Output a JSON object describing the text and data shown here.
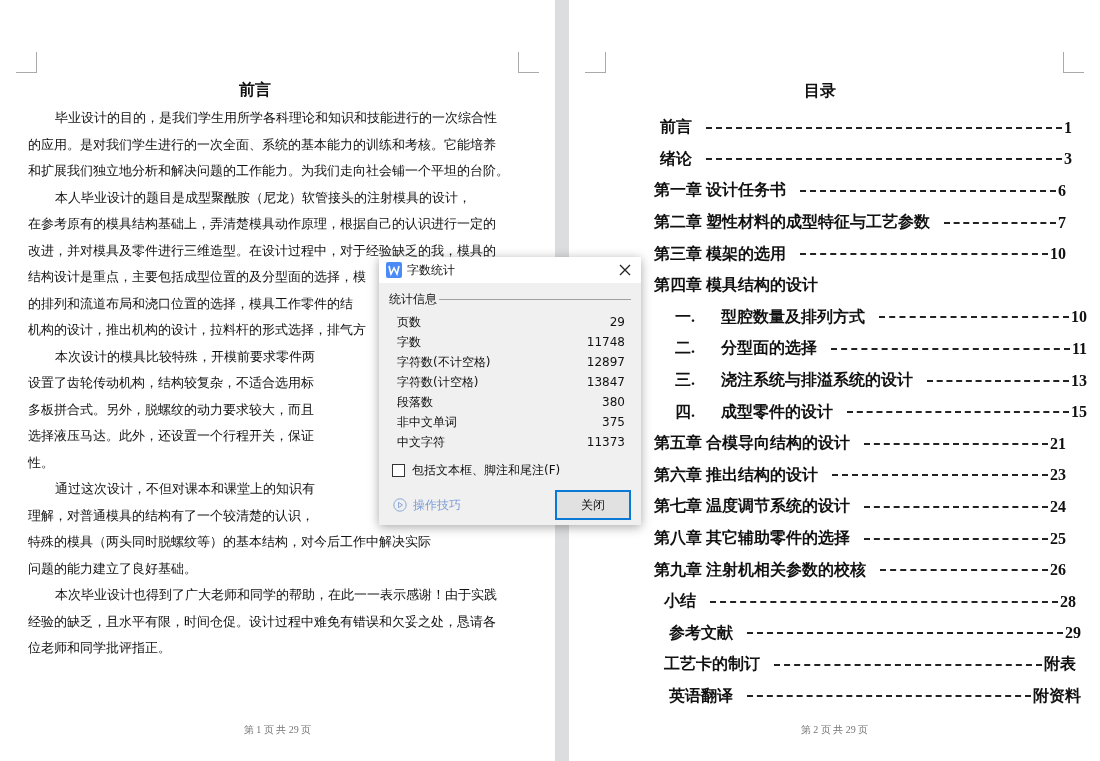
{
  "left_page": {
    "heading": "前言",
    "lines": [
      {
        "text": "毕业设计的目的，是我们学生用所学各科理论和知识和技能进行的一次综合性",
        "indent": true
      },
      {
        "text": "的应用。是对我们学生进行的一次全面、系统的基本能力的训练和考核。它能培养",
        "indent": false
      },
      {
        "text": "和扩展我们独立地分析和解决问题的工作能力。为我们走向社会铺一个平坦的台阶。",
        "indent": false
      },
      {
        "text": "本人毕业设计的题目是成型聚酰胺（尼龙）软管接头的注射模具的设计，",
        "indent": true
      },
      {
        "text": "在参考原有的模具结构基础上，弄清楚模具动作原理，根据自己的认识进行一定的",
        "indent": false
      },
      {
        "text": "改进，并对模具及零件进行三维造型。在设计过程中，对于经验缺乏的我，模具的",
        "indent": false
      },
      {
        "text": "结构设计是重点，主要包括成型位置的及分型面的选择，模",
        "indent": false
      },
      {
        "text": "的排列和流道布局和浇口位置的选择，模具工作零件的结",
        "indent": false
      },
      {
        "text": "机构的设计，推出机构的设计，拉料杆的形式选择，排气方",
        "indent": false
      },
      {
        "text": "本次设计的模具比较特殊，开模前要求零件两",
        "indent": true
      },
      {
        "text": "设置了齿轮传动机构，结构较复杂，不适合选用标",
        "indent": false
      },
      {
        "text": "多板拼合式。另外，脱螺纹的动力要求较大，而且",
        "indent": false
      },
      {
        "text": "选择液压马达。此外，还设置一个行程开关，保证",
        "indent": false
      },
      {
        "text": "性。",
        "indent": false
      },
      {
        "text": "通过这次设计，不但对课本和课堂上的知识有",
        "indent": true
      },
      {
        "text": "理解，对普通模具的结构有了一个较清楚的认识，",
        "indent": false
      },
      {
        "text": "特殊的模具（两头同时脱螺纹等）的基本结构，对今后工作中解决实际",
        "indent": false
      },
      {
        "text": "问题的能力建立了良好基础。",
        "indent": false
      },
      {
        "text": "本次毕业设计也得到了广大老师和同学的帮助，在此一一表示感谢！由于实践",
        "indent": true
      },
      {
        "text": "经验的缺乏，且水平有限，时间仓促。设计过程中难免有错误和欠妥之处，恳请各",
        "indent": false
      },
      {
        "text": "位老师和同学批评指正。",
        "indent": false
      }
    ],
    "footer": "第 1 页 共 29 页"
  },
  "right_page": {
    "heading": "目录",
    "toc": [
      {
        "kind": "front",
        "title": "前言",
        "page": "1"
      },
      {
        "kind": "front",
        "title": "绪论",
        "page": "3"
      },
      {
        "kind": "chapter",
        "title": "第一章  设计任务书",
        "page": "6"
      },
      {
        "kind": "chapter",
        "title": "第二章  塑性材料的成型特征与工艺参数",
        "page": "7"
      },
      {
        "kind": "chapter",
        "title": "第三章  模架的选用",
        "page": "10"
      },
      {
        "kind": "chapter",
        "title": "第四章  模具结构的设计"
      },
      {
        "kind": "section",
        "number": "一.",
        "title": "型腔数量及排列方式",
        "page": "10"
      },
      {
        "kind": "section",
        "number": "二.",
        "title": "分型面的选择",
        "page": "11"
      },
      {
        "kind": "section",
        "number": "三.",
        "title": "浇注系统与排溢系统的设计",
        "page": "13"
      },
      {
        "kind": "section",
        "number": "四.",
        "title": "成型零件的设计",
        "page": "15"
      },
      {
        "kind": "chapter",
        "title": "第五章  合模导向结构的设计",
        "page": "21"
      },
      {
        "kind": "chapter",
        "title": "第六章  推出结构的设计",
        "page": "23"
      },
      {
        "kind": "chapter",
        "title": "第七章  温度调节系统的设计",
        "page": "24"
      },
      {
        "kind": "chapter",
        "title": "第八章  其它辅助零件的选择",
        "page": "25"
      },
      {
        "kind": "chapter",
        "title": "第九章  注射机相关参数的校核",
        "page": "26"
      },
      {
        "kind": "back",
        "title": "小结",
        "page": "28"
      },
      {
        "kind": "back2",
        "title": "参考文献",
        "page": "29"
      },
      {
        "kind": "back",
        "title": "工艺卡的制订",
        "page": "附表"
      },
      {
        "kind": "back2",
        "title": "英语翻译",
        "page": "附资料"
      }
    ],
    "footer": "第 2 页 共 29 页"
  },
  "dialog": {
    "title": "字数统计",
    "group_label": "统计信息",
    "stats": [
      {
        "label": "页数",
        "value": "29"
      },
      {
        "label": "字数",
        "value": "11748"
      },
      {
        "label": "字符数(不计空格)",
        "value": "12897"
      },
      {
        "label": "字符数(计空格)",
        "value": "13847"
      },
      {
        "label": "段落数",
        "value": "380"
      },
      {
        "label": "非中文单词",
        "value": "375"
      },
      {
        "label": "中文字符",
        "value": "11373"
      }
    ],
    "checkbox": {
      "label": "包括文本框、脚注和尾注(F)",
      "checked": false
    },
    "link": "操作技巧",
    "button": "关闭"
  }
}
